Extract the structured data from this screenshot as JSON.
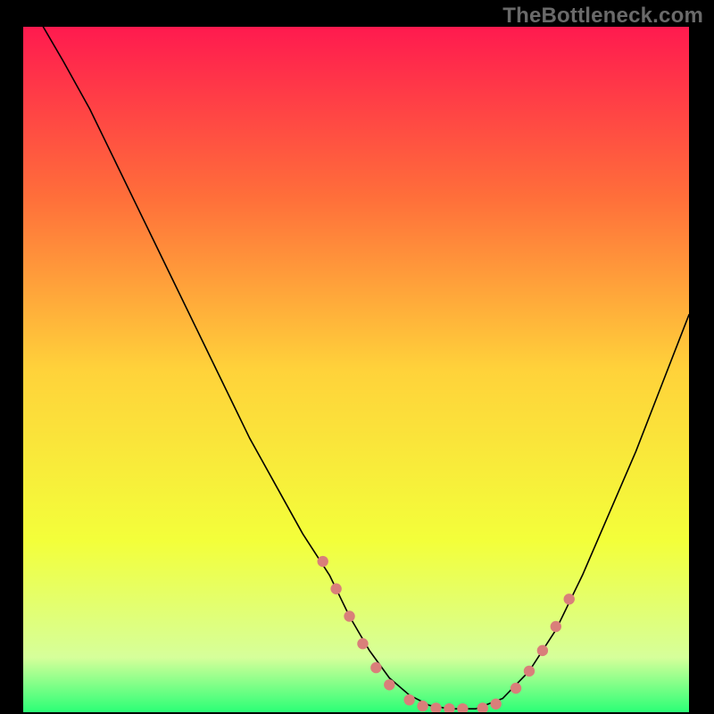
{
  "watermark": "TheBottleneck.com",
  "chart_data": {
    "type": "line",
    "title": "",
    "xlabel": "",
    "ylabel": "",
    "xlim": [
      0,
      100
    ],
    "ylim": [
      0,
      100
    ],
    "grid": false,
    "legend": false,
    "gradient_stops": [
      {
        "offset": 0.0,
        "color": "#ff1a4f"
      },
      {
        "offset": 0.25,
        "color": "#ff6f3a"
      },
      {
        "offset": 0.5,
        "color": "#ffd23a"
      },
      {
        "offset": 0.75,
        "color": "#f3ff3a"
      },
      {
        "offset": 0.92,
        "color": "#d6ff9a"
      },
      {
        "offset": 1.0,
        "color": "#2bff76"
      }
    ],
    "series": [
      {
        "name": "bottleneck-curve",
        "stroke": "#000000",
        "stroke_width": 1.6,
        "x": [
          3,
          6,
          10,
          14,
          18,
          22,
          26,
          30,
          34,
          38,
          42,
          46,
          49,
          52,
          55,
          58,
          61,
          64,
          68,
          72,
          76,
          80,
          84,
          88,
          92,
          96,
          100
        ],
        "values": [
          100,
          95,
          88,
          80,
          72,
          64,
          56,
          48,
          40,
          33,
          26,
          20,
          14,
          9,
          5,
          2.5,
          1,
          0.5,
          0.5,
          2,
          6,
          12,
          20,
          29,
          38,
          48,
          58
        ]
      }
    ],
    "markers": {
      "color": "#d97f7a",
      "radius": 6.2,
      "points": [
        {
          "x": 45,
          "y": 22
        },
        {
          "x": 47,
          "y": 18
        },
        {
          "x": 49,
          "y": 14
        },
        {
          "x": 51,
          "y": 10
        },
        {
          "x": 53,
          "y": 6.5
        },
        {
          "x": 55,
          "y": 4
        },
        {
          "x": 58,
          "y": 1.8
        },
        {
          "x": 60,
          "y": 0.9
        },
        {
          "x": 62,
          "y": 0.6
        },
        {
          "x": 64,
          "y": 0.5
        },
        {
          "x": 66,
          "y": 0.5
        },
        {
          "x": 69,
          "y": 0.6
        },
        {
          "x": 71,
          "y": 1.2
        },
        {
          "x": 74,
          "y": 3.5
        },
        {
          "x": 76,
          "y": 6
        },
        {
          "x": 78,
          "y": 9
        },
        {
          "x": 80,
          "y": 12.5
        },
        {
          "x": 82,
          "y": 16.5
        }
      ]
    }
  }
}
